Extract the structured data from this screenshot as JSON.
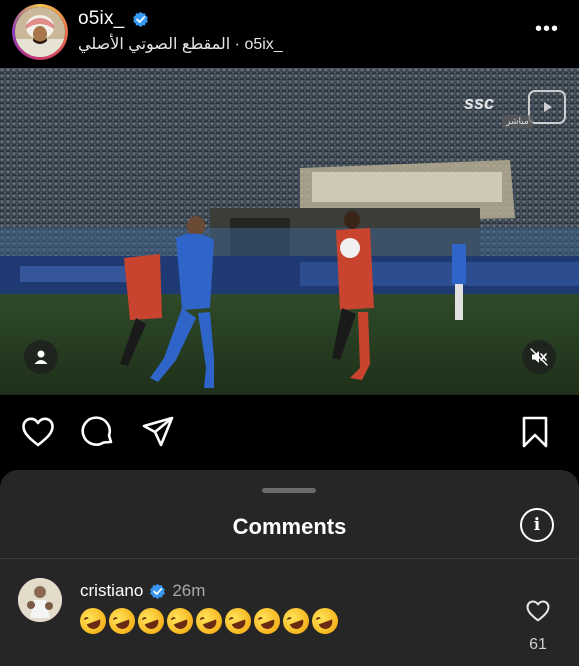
{
  "header": {
    "username": "o5ix_",
    "audio_label": "المقطع الصوتي الأصلي · o5ix_",
    "more_label": "•••"
  },
  "video": {
    "broadcaster": "ssc",
    "live_label": "مباشر"
  },
  "actions": {
    "icons": [
      "heart-icon",
      "comment-icon",
      "share-icon",
      "bookmark-icon"
    ]
  },
  "comments_sheet": {
    "title": "Comments",
    "info_label": "i"
  },
  "comments": [
    {
      "username": "cristiano",
      "verified": true,
      "time": "26m",
      "emoji_name": "rolling-on-the-floor-laughing",
      "emoji_count": 9,
      "likes": "61"
    }
  ],
  "colors": {
    "background": "#000000",
    "sheet": "#262626",
    "verified": "#3897f0",
    "muted_text": "#a8a8a8"
  }
}
